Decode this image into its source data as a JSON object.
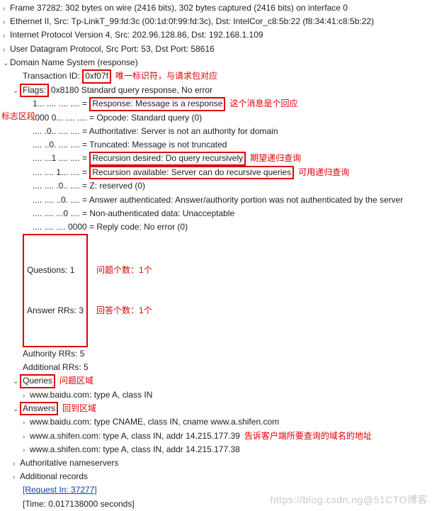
{
  "arrows": {
    "right": "›",
    "down": "⌄"
  },
  "frame": "Frame 37282: 302 bytes on wire (2416 bits), 302 bytes captured (2416 bits) on interface 0",
  "eth": "Ethernet II, Src: Tp-LinkT_99:fd:3c (00:1d:0f:99:fd:3c), Dst: IntelCor_c8:5b:22 (f8:34:41:c8:5b:22)",
  "ip": "Internet Protocol Version 4, Src: 202.96.128.86, Dst: 192.168.1.109",
  "udp": "User Datagram Protocol, Src Port: 53, Dst Port: 58616",
  "dns_header": "Domain Name System (response)",
  "txn_label": "Transaction ID: ",
  "txn_id": "0xf07f",
  "txn_anno": "唯一标识符，与请求包对应",
  "flags_label": "Flags:",
  "flags_val": " 0x8180 Standard query response, No error",
  "flags_anno_left": "标志区段",
  "f1_bits": "1... .... .... .... = ",
  "f1_text": "Response: Message is a response",
  "f1_anno": "这个消息是个回应",
  "f2": ".000 0... .... .... = Opcode: Standard query (0)",
  "f3": ".... .0.. .... .... = Authoritative: Server is not an authority for domain",
  "f4": ".... ..0. .... .... = Truncated: Message is not truncated",
  "f5_bits": ".... ...1 .... .... = ",
  "f5_text": "Recursion desired: Do query recursively",
  "f5_anno": "期望递归查询",
  "f6_bits": ".... .... 1... .... = ",
  "f6_text": "Recursion available: Server can do recursive queries",
  "f6_anno": "可用递归查询",
  "f7": ".... .... .0.. .... = Z: reserved (0)",
  "f8": ".... .... ..0. .... = Answer authenticated: Answer/authority portion was not authenticated by the server",
  "f9": ".... .... ...0 .... = Non-authenticated data: Unacceptable",
  "f10": ".... .... .... 0000 = Reply code: No error (0)",
  "questions": "Questions: 1",
  "questions_anno": "问题个数：1个",
  "answer_rrs": "Answer RRs: 3",
  "answer_rrs_anno": "回答个数：1个",
  "authority_rrs": "Authority RRs: 5",
  "additional_rrs": "Additional RRs: 5",
  "queries": "Queries",
  "queries_anno": "问题区域",
  "query1": "www.baidu.com: type A, class IN",
  "answers": "Answers",
  "answers_anno": "回到区域",
  "ans1": "www.baidu.com: type CNAME, class IN, cname www.a.shifen.com",
  "ans2": "www.a.shifen.com: type A, class IN, addr 14.215.177.39",
  "ans2_anno": "告诉客户端所要查询的域名的地址",
  "ans3": "www.a.shifen.com: type A, class IN, addr 14.215.177.38",
  "auth_ns": "Authoritative nameservers",
  "add_rec": "Additional records",
  "req_in": "[Request In: 37277]",
  "time": "[Time: 0.017138000 seconds]",
  "watermark": "https://blog.csdn.ng@51CTO博客"
}
